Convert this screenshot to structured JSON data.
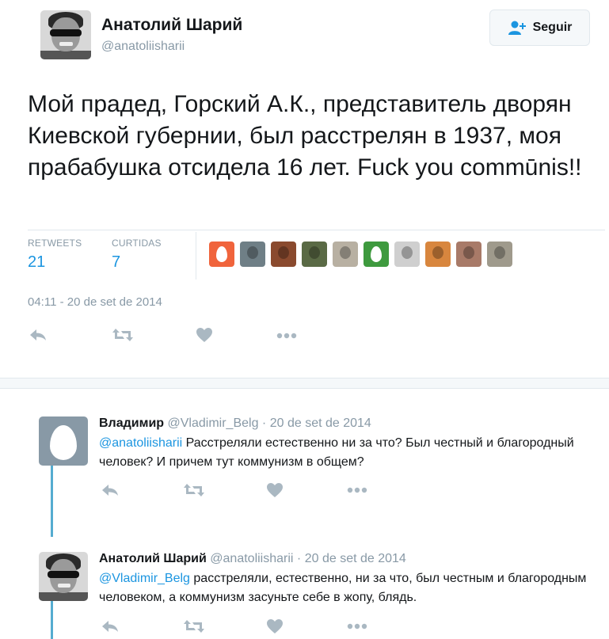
{
  "tweet": {
    "author_name": "Анатолий Шарий",
    "author_handle": "@anatoliisharii",
    "follow_label": "Seguir",
    "text": "Мой прадед, Горский А.К., представитель дворян Киевской губернии, был расстрелян в 1937, моя прабабушка отсидела 16 лет. Fuck you commūnis!!",
    "stats": {
      "retweets_label": "RETWEETS",
      "retweets_value": "21",
      "likes_label": "CURTIDAS",
      "likes_value": "7"
    },
    "timestamp": "04:11 - 20 de set de 2014"
  },
  "likers": [
    {
      "icon": "egg-avatar-icon",
      "color": "#f0643c"
    },
    {
      "icon": "user-avatar-icon",
      "color": "#6f7f86"
    },
    {
      "icon": "user-avatar-icon",
      "color": "#8a4a2e"
    },
    {
      "icon": "user-avatar-icon",
      "color": "#5a6a45"
    },
    {
      "icon": "user-avatar-icon",
      "color": "#b8b0a2"
    },
    {
      "icon": "egg-avatar-icon",
      "color": "#3e9a3e"
    },
    {
      "icon": "user-avatar-icon",
      "color": "#cfcfcf"
    },
    {
      "icon": "user-avatar-icon",
      "color": "#d8863e"
    },
    {
      "icon": "user-avatar-icon",
      "color": "#a87a68"
    },
    {
      "icon": "user-avatar-icon",
      "color": "#9f9a8c"
    }
  ],
  "replies": [
    {
      "name": "Владимир",
      "handle": "@Vladimir_Belg",
      "separator": "·",
      "date": "20 de set de 2014",
      "mention": "@anatoliisharii",
      "text": " Расстреляли естественно ни за что? Был честный и благородный человек? И причем тут коммунизм в общем?"
    },
    {
      "name": "Анатолий Шарий",
      "handle": "@anatoliisharii",
      "separator": "·",
      "date": "20 de set de 2014",
      "mention": "@Vladimir_Belg",
      "text": " расстреляли, естественно, ни за что, был честным и благородным человеком, а коммунизм засуньте себе в жопу, блядь."
    }
  ],
  "colors": {
    "accent": "#1b95e0",
    "muted": "#8899a6",
    "icon": "#aab8c2",
    "thread_line": "#55acd0"
  }
}
